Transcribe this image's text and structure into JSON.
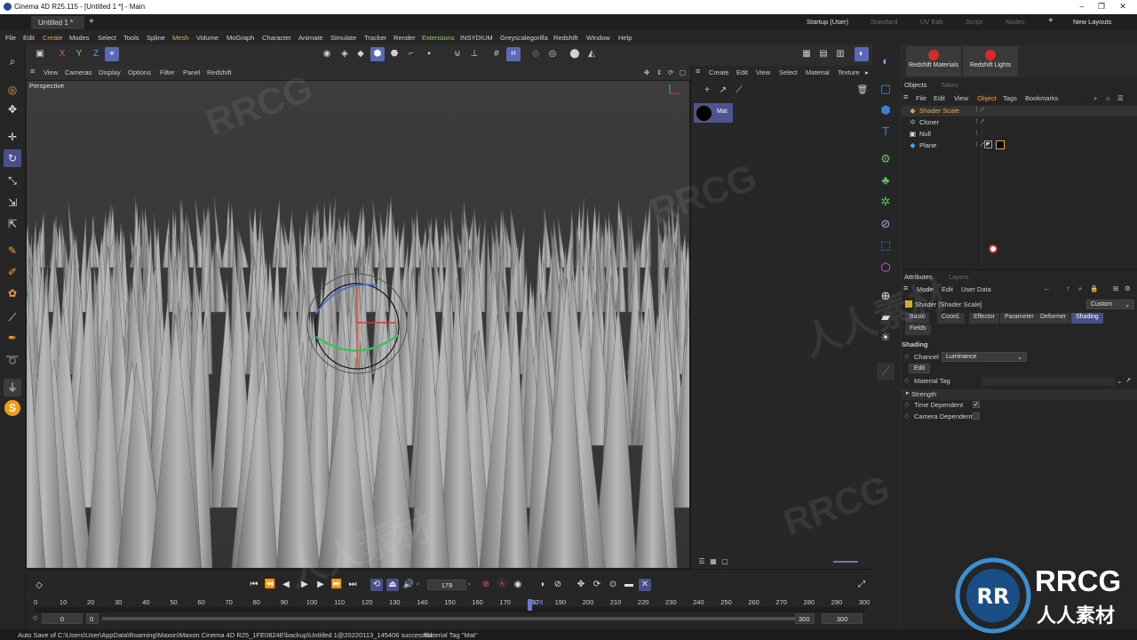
{
  "window": {
    "title": "Cinema 4D R25.115 - [Untitled 1 *] - Main"
  },
  "tabs": {
    "doc": "Untitled 1 *",
    "plus": "+"
  },
  "layouts": [
    {
      "label": "Startup (User)",
      "active": true
    },
    {
      "label": "Standard"
    },
    {
      "label": "UV Edit"
    },
    {
      "label": "Script"
    },
    {
      "label": "Nodes"
    },
    {
      "label": "+"
    },
    {
      "label": "New Layouts"
    }
  ],
  "menu": [
    "File",
    "Edit",
    "Create",
    "Modes",
    "Select",
    "Tools",
    "Spline",
    "Mesh",
    "Volume",
    "MoGraph",
    "Character",
    "Animate",
    "Simulate",
    "Tracker",
    "Render",
    "Extensions",
    "INSYDIUM",
    "Greyscalegorilla",
    "Redshift",
    "Window",
    "Help"
  ],
  "toolbar": {
    "x": "X",
    "y": "Y",
    "z": "Z"
  },
  "viewport_menu": [
    "View",
    "Cameras",
    "Display",
    "Options",
    "Filter",
    "Panel",
    "Redshift"
  ],
  "viewport": {
    "label": "Perspective"
  },
  "material_menu": [
    "Create",
    "Edit",
    "View",
    "Select",
    "Material",
    "Texture"
  ],
  "material": {
    "name": "Mat"
  },
  "redshift": {
    "materials": "Redshift Materials",
    "lights": "Redshift Lights"
  },
  "objects_panel": {
    "tabs": [
      "Objects",
      "Takes"
    ],
    "menu": [
      "File",
      "Edit",
      "View",
      "Object",
      "Tags",
      "Bookmarks"
    ],
    "rows": [
      {
        "name": "Shader Scale",
        "icon": "shader-icon",
        "selected": true
      },
      {
        "name": "Cloner",
        "icon": "cloner-icon"
      },
      {
        "name": "Null",
        "icon": "null-icon"
      },
      {
        "name": "Plane",
        "icon": "plane-icon"
      }
    ]
  },
  "attributes": {
    "tabs": [
      "Attributes",
      "Layers"
    ],
    "menu": [
      "Mode",
      "Edit",
      "User Data"
    ],
    "object_title": "Shader [Shader Scale]",
    "preset": "Custom",
    "subtabs": [
      "Basic",
      "Coord.",
      "Effector",
      "Parameter",
      "Deformer",
      "Shading",
      "Fields"
    ],
    "active_subtab": "Shading",
    "section": "Shading",
    "channel_label": "Channel",
    "channel_value": "Luminance",
    "edit_button": "Edit",
    "material_tag_label": "Material Tag",
    "strength_label": "Strength",
    "time_dependent_label": "Time Dependent",
    "time_dependent": true,
    "camera_dependent_label": "Camera Dependent",
    "camera_dependent": false
  },
  "timeline": {
    "current_frame": "178",
    "marker": "178",
    "ticks": [
      "0",
      "10",
      "20",
      "30",
      "40",
      "50",
      "60",
      "70",
      "80",
      "90",
      "100",
      "110",
      "120",
      "130",
      "140",
      "150",
      "160",
      "170",
      "180",
      "190",
      "200",
      "210",
      "220",
      "230",
      "240",
      "250",
      "260",
      "270",
      "280",
      "290",
      "300"
    ],
    "start": "0",
    "start2": "0",
    "end": "300",
    "end2": "300"
  },
  "status": {
    "autosave": "Auto Save of C:\\Users\\User\\AppData\\Roaming\\Maxon\\Maxon Cinema 4D R25_1FE0824E\\backup\\Untitled 1@20220113_145406 successful",
    "tag": "Material Tag \"Mat\""
  },
  "watermark": {
    "text": "RRCG",
    "subtext": "人人素材"
  },
  "colors": {
    "accent": "#5969b4",
    "orange": "#f0a640",
    "record_red": "#e14b4b"
  }
}
